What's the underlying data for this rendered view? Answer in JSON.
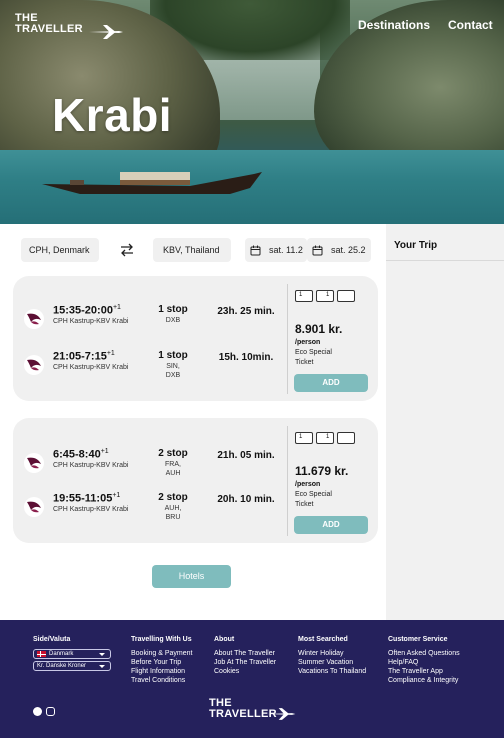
{
  "header": {
    "logo_line1": "THE",
    "logo_line2": "TRAVELLER",
    "nav": [
      "Destinations",
      "Contact"
    ]
  },
  "hero": {
    "title": "Krabi"
  },
  "search": {
    "from": "CPH, Denmark",
    "to": "KBV, Thailand",
    "depart": "sat. 11.2",
    "return": "sat. 25.2"
  },
  "trip_panel": {
    "title": "Your Trip"
  },
  "cards": [
    {
      "flights": [
        {
          "time": "15:35-20:00",
          "plus": "+1",
          "route": "CPH Kastrup-KBV Krabi",
          "stops": "1 stop",
          "via": [
            "DXB"
          ],
          "duration": "23h. 25 min."
        },
        {
          "time": "21:05-7:15",
          "plus": "+1",
          "route": "CPH Kastrup-KBV Krabi",
          "stops": "1 stop",
          "via": [
            "SIN,",
            "DXB"
          ],
          "duration": "15h. 10min."
        }
      ],
      "baggage": [
        "1",
        "1"
      ],
      "price": "8.901 kr.",
      "per": "/person",
      "ticket": [
        "Eco Special",
        "Ticket"
      ],
      "add": "ADD"
    },
    {
      "flights": [
        {
          "time": "6:45-8:40",
          "plus": "+1",
          "route": "CPH Kastrup-KBV Krabi",
          "stops": "2 stop",
          "via": [
            "FRA,",
            "AUH"
          ],
          "duration": "21h. 05 min."
        },
        {
          "time": "19:55-11:05",
          "plus": "+1",
          "route": "CPH Kastrup-KBV Krabi",
          "stops": "2 stop",
          "via": [
            "AUH,",
            "BRU"
          ],
          "duration": "20h. 10 min."
        }
      ],
      "baggage": [
        "1",
        "1"
      ],
      "price": "11.679 kr.",
      "per": "/person",
      "ticket": [
        "Eco Special",
        "Ticket"
      ],
      "add": "ADD"
    }
  ],
  "hotels_button": "Hotels",
  "footer": {
    "side_valuta": {
      "title": "Side/Valuta",
      "country": "Danmark",
      "currency": "Kr. Danske Kroner"
    },
    "travelling": {
      "title": "Travelling With Us",
      "items": [
        "Booking & Payment",
        "Before Your Trip",
        "Flight Information",
        "Travel Conditions"
      ]
    },
    "about": {
      "title": "About",
      "items": [
        "About The Traveller",
        "Job At The Traveller",
        "Cookies"
      ]
    },
    "most_searched": {
      "title": "Most Searched",
      "items": [
        "Winter Holiday",
        "Summer Vacation",
        "Vacations To Thailand"
      ]
    },
    "customer_service": {
      "title": "Customer Service",
      "items": [
        "Often Asked Questions",
        "Help/FAQ",
        "The Traveller App",
        "Compliance & Integrity"
      ]
    },
    "logo_line1": "THE",
    "logo_line2": "TRAVELLER"
  },
  "colors": {
    "accent": "#7fbcbd",
    "footer_bg": "#25215c",
    "card_bg": "#f0f0f0"
  }
}
